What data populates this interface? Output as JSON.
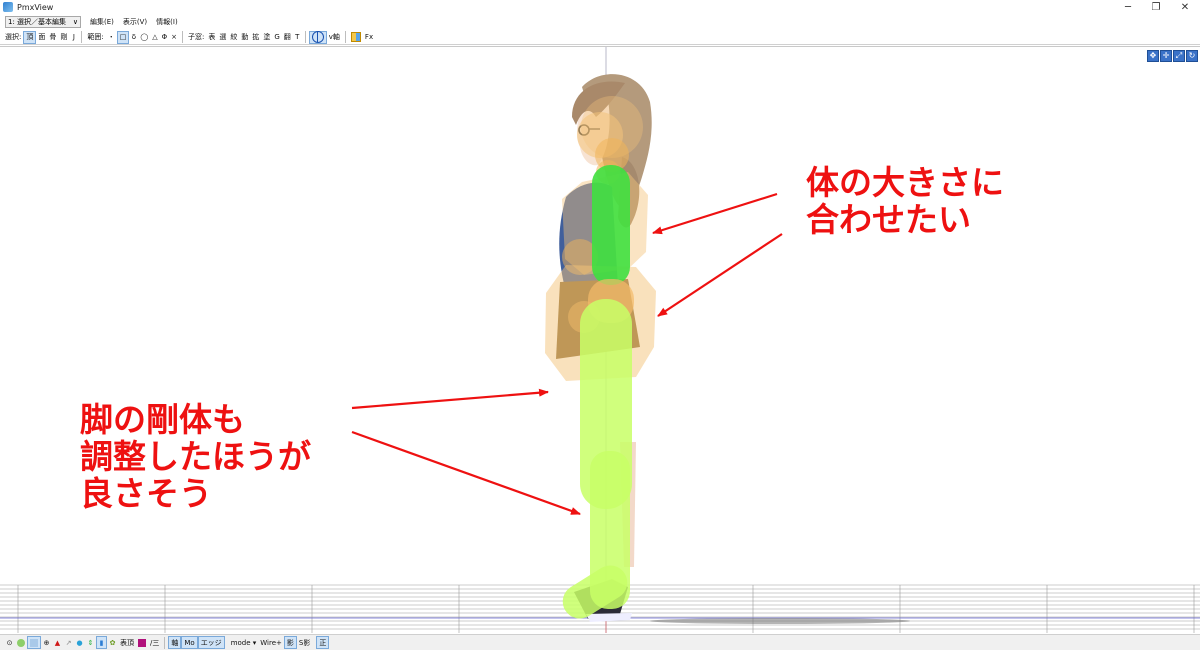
{
  "window": {
    "title": "PmxView",
    "minimize": "─",
    "restore": "❐",
    "close": "✕"
  },
  "menubar": {
    "mode_select": "1: 選択／基本編集",
    "items": [
      "編集(E)",
      "表示(V)",
      "情報(I)"
    ]
  },
  "toolbar": {
    "select_label": "選択:",
    "select_items": [
      "頂",
      "面",
      "骨",
      "剛",
      "J"
    ],
    "range_label": "範囲:",
    "range_items": [
      "・",
      "□",
      "δ",
      "◯",
      "△",
      "Φ",
      "×"
    ],
    "child_label": "子窓:",
    "child_items": [
      "表",
      "選",
      "絞",
      "動",
      "拡",
      "塗",
      "G",
      "翻",
      "T"
    ],
    "vaxis_label": "v軸",
    "fx_label": "Fx"
  },
  "viewport": {
    "nav_icons": [
      "move-icon",
      "rotate-icon",
      "zoom-icon",
      "reset-icon"
    ]
  },
  "annotations": {
    "body": [
      "体の大きさに",
      "合わせたい"
    ],
    "leg": [
      "脚の剛体も",
      "調整したほうが",
      "良さそう"
    ]
  },
  "statusbar": {
    "items": [
      "表頂",
      "/三",
      "軸",
      "Mo",
      "エッジ",
      "mode ▾",
      "Wire+",
      "影",
      "S影",
      "正"
    ]
  },
  "colors": {
    "arrow": "#ee1111",
    "rigid_arm": "#3fe03f",
    "rigid_leg": "#c8ff66",
    "rigid_body": "#f4c47a"
  }
}
